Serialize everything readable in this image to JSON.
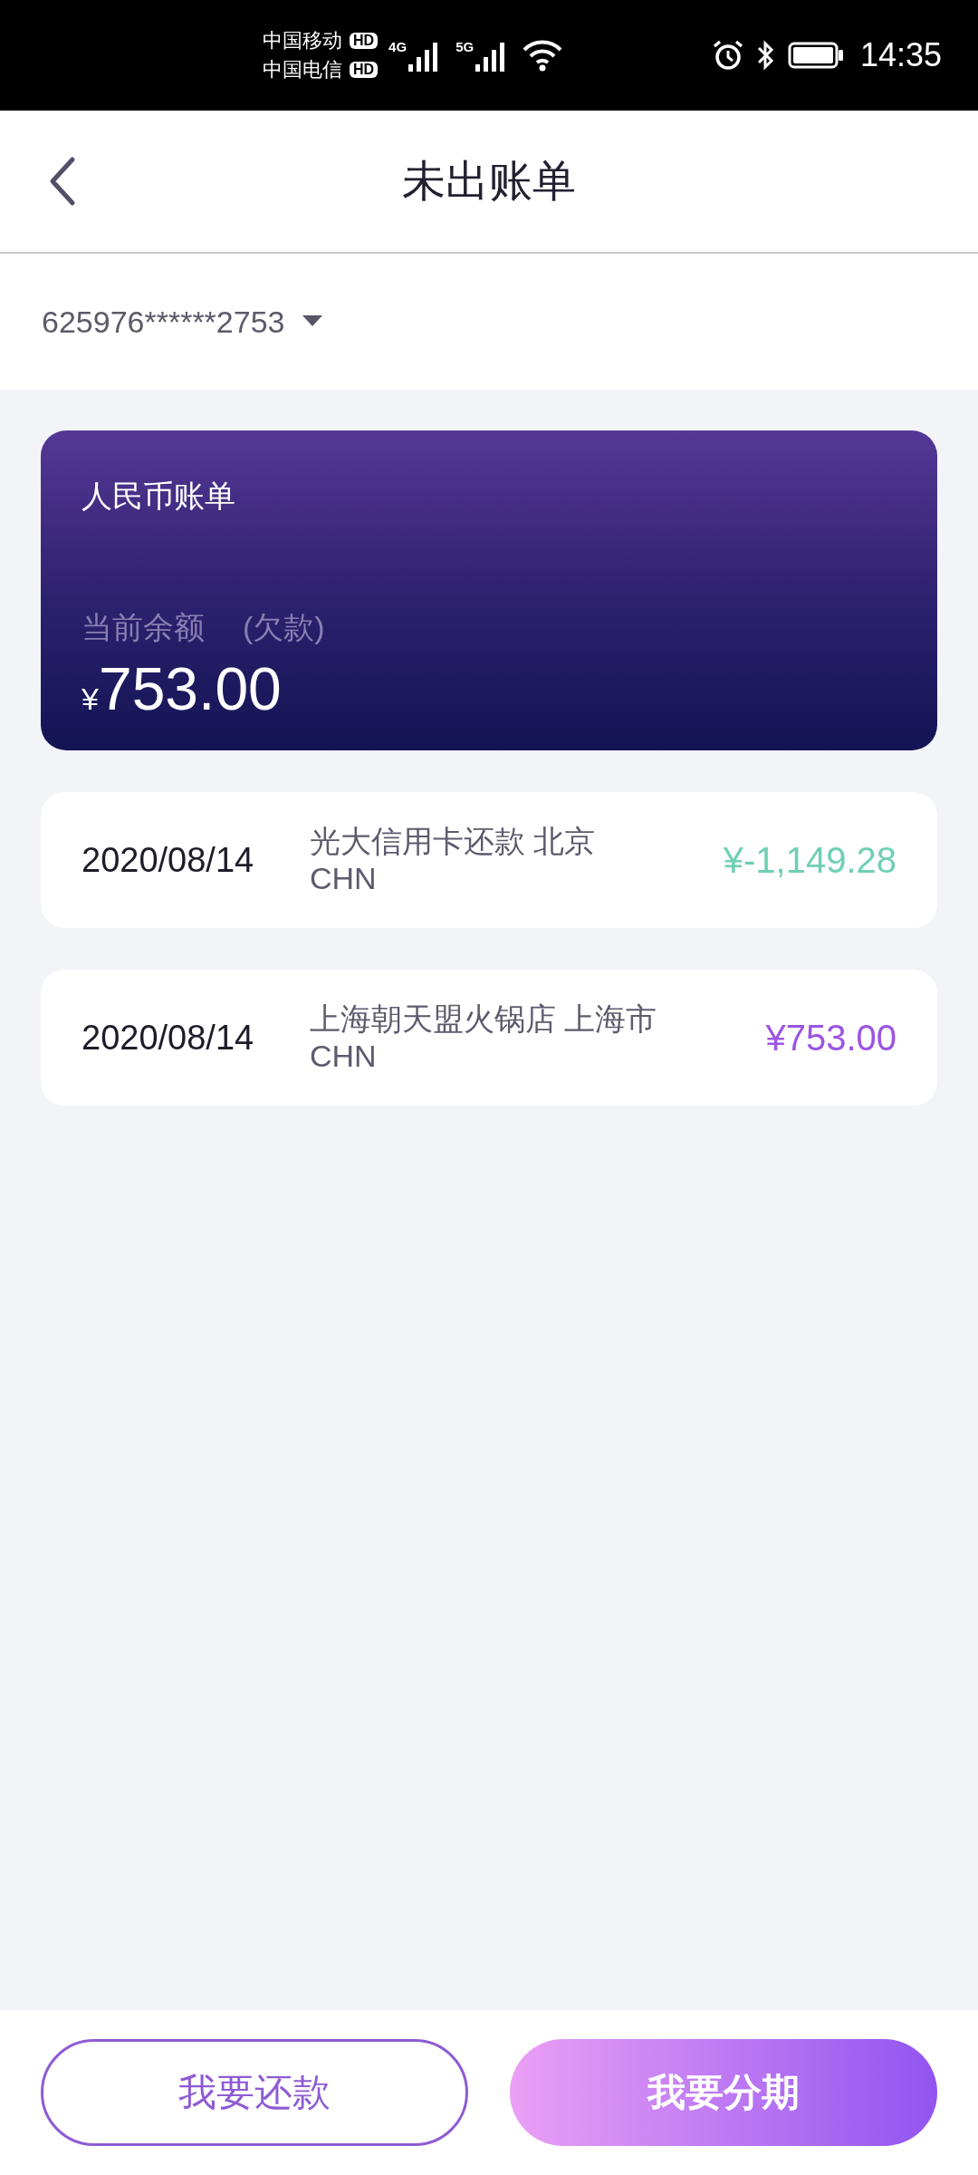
{
  "status_bar": {
    "carriers": [
      {
        "name": "中国移动",
        "badge": "HD",
        "network": "4G"
      },
      {
        "name": "中国电信",
        "badge": "HD",
        "network": "5G"
      }
    ],
    "time": "14:35"
  },
  "header": {
    "title": "未出账单"
  },
  "card_selector": {
    "value": "625976******2753"
  },
  "bill_card": {
    "title": "人民币账单",
    "balance_label": "当前余额",
    "balance_note": "(欠款)",
    "currency": "¥",
    "amount": "753.00"
  },
  "transactions": [
    {
      "date": "2020/08/14",
      "merchant": "光大信用卡还款 北京",
      "country": "CHN",
      "amount": "¥-1,149.28",
      "kind": "credit"
    },
    {
      "date": "2020/08/14",
      "merchant": "上海朝天盟火锅店 上海市",
      "country": "CHN",
      "amount": "¥753.00",
      "kind": "debit"
    }
  ],
  "buttons": [
    {
      "label": "我要还款",
      "kind": "outline"
    },
    {
      "label": "我要分期",
      "kind": "filled"
    }
  ]
}
